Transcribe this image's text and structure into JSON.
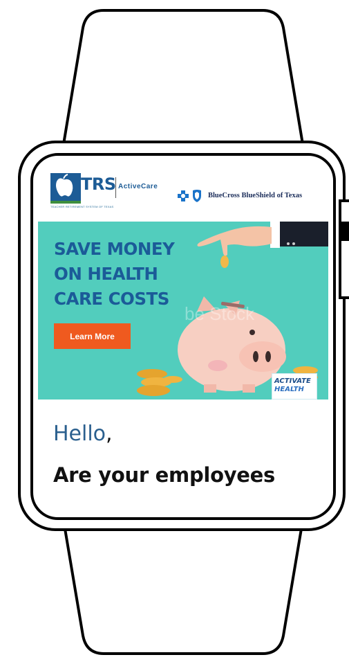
{
  "header": {
    "trs_logo": {
      "text": "TRS",
      "active_care": "ActiveCare",
      "tagline": "TEACHER RETIREMENT SYSTEM OF TEXAS"
    },
    "bcbs_logo": {
      "text": "BlueCross BlueShield of Texas"
    }
  },
  "banner": {
    "headline_lines": [
      "SAVE MONEY",
      "ON HEALTH",
      "CARE COSTS"
    ],
    "button_label": "Learn More",
    "watermark": "be Stock",
    "activate_badge": {
      "line1": "ACTIVATE",
      "line2": "HEALTH"
    }
  },
  "body": {
    "greeting": "Hello",
    "greeting_punct": ",",
    "subheading": "Are your employees"
  },
  "colors": {
    "banner_bg": "#52cdbd",
    "headline": "#1b5b98",
    "button": "#ef5a1f",
    "greeting": "#2a5f8e"
  }
}
